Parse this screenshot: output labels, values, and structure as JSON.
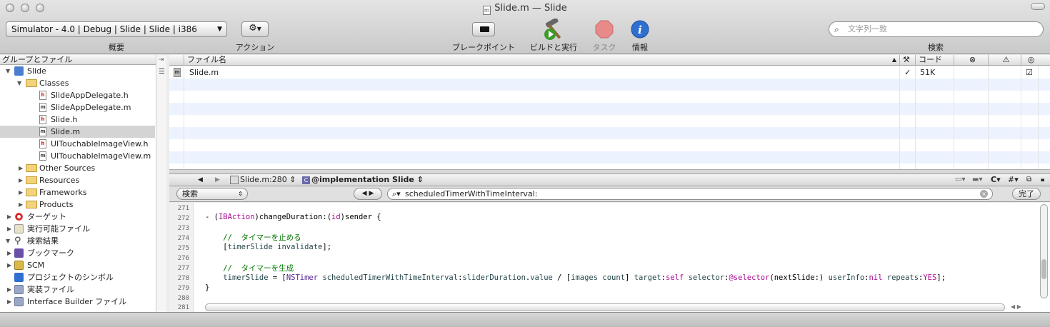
{
  "window": {
    "title": "Slide.m — Slide",
    "doc_icon": "m"
  },
  "toolbar": {
    "scheme": "Simulator - 4.0 | Debug | Slide | Slide | i386",
    "scheme_label": "概要",
    "action_label": "アクション",
    "breakpoints_label": "ブレークポイント",
    "build_label": "ビルドと実行",
    "tasks_label": "タスク",
    "info_label": "情報",
    "search_placeholder": "文字列一致",
    "search_label": "検索"
  },
  "sidebar": {
    "header": "グループとファイル",
    "items": [
      {
        "label": "Slide"
      },
      {
        "label": "Classes"
      },
      {
        "label": "SlideAppDelegate.h",
        "icon": "h"
      },
      {
        "label": "SlideAppDelegate.m",
        "icon": "m"
      },
      {
        "label": "Slide.h",
        "icon": "h"
      },
      {
        "label": "Slide.m",
        "icon": "m"
      },
      {
        "label": "UITouchableImageView.h",
        "icon": "h"
      },
      {
        "label": "UITouchableImageView.m",
        "icon": "m"
      },
      {
        "label": "Other Sources"
      },
      {
        "label": "Resources"
      },
      {
        "label": "Frameworks"
      },
      {
        "label": "Products"
      },
      {
        "label": "ターゲット"
      },
      {
        "label": "実行可能ファイル"
      },
      {
        "label": "検索結果"
      },
      {
        "label": "ブックマーク"
      },
      {
        "label": "SCM"
      },
      {
        "label": "プロジェクトのシンボル"
      },
      {
        "label": "実装ファイル"
      },
      {
        "label": "Interface Builder ファイル"
      }
    ]
  },
  "filelist": {
    "col_name": "ファイル名",
    "col_code": "コード",
    "rows": [
      {
        "name": "Slide.m",
        "checked": "✓",
        "code": "51K",
        "target": "☑"
      }
    ]
  },
  "editor": {
    "file_position": "Slide.m:280 ⇕",
    "symbol": "@implementation Slide ⇕",
    "lang_menu": "C",
    "counterpart": "#",
    "find_mode": "検索",
    "find_query": "scheduledTimerWithTimeInterval:",
    "done": "完了"
  },
  "code": {
    "line_numbers": [
      "271",
      "272",
      "273",
      "274",
      "275",
      "276",
      "277",
      "278",
      "279",
      "280",
      "281"
    ]
  },
  "colors": {
    "keyword": "#aa0d91",
    "class": "#5c2699",
    "comment": "#007400",
    "selection": "#d4d4d4",
    "stripe": "#edf3fe"
  }
}
